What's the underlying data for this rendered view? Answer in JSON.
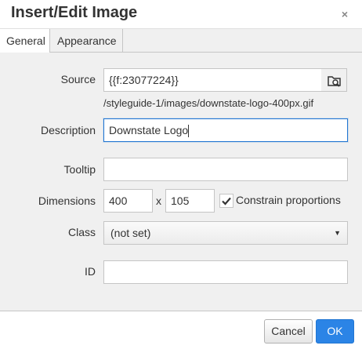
{
  "dialog": {
    "title": "Insert/Edit Image",
    "close_symbol": "×"
  },
  "tabs": [
    {
      "label": "General",
      "active": true
    },
    {
      "label": "Appearance",
      "active": false
    }
  ],
  "form": {
    "source": {
      "label": "Source",
      "value": "{{f:23077224}}",
      "hint": "/styleguide-1/images/downstate-logo-400px.gif"
    },
    "description": {
      "label": "Description",
      "value": "Downstate Logo"
    },
    "tooltip": {
      "label": "Tooltip",
      "value": ""
    },
    "dimensions": {
      "label": "Dimensions",
      "width": "400",
      "separator": "x",
      "height": "105"
    },
    "constrain": {
      "label": "Constrain proportions",
      "checked": true
    },
    "class": {
      "label": "Class",
      "selected": "(not set)"
    },
    "id": {
      "label": "ID",
      "value": ""
    }
  },
  "buttons": {
    "cancel": "Cancel",
    "ok": "OK"
  },
  "icons": {
    "browse": "browse-folder-icon",
    "close": "close-icon",
    "check": "checkmark-icon",
    "dropdown": "caret-down-icon"
  },
  "colors": {
    "accent": "#2b84e6",
    "focus_border": "#2276d2",
    "panel_bg": "#f0f0f0"
  }
}
